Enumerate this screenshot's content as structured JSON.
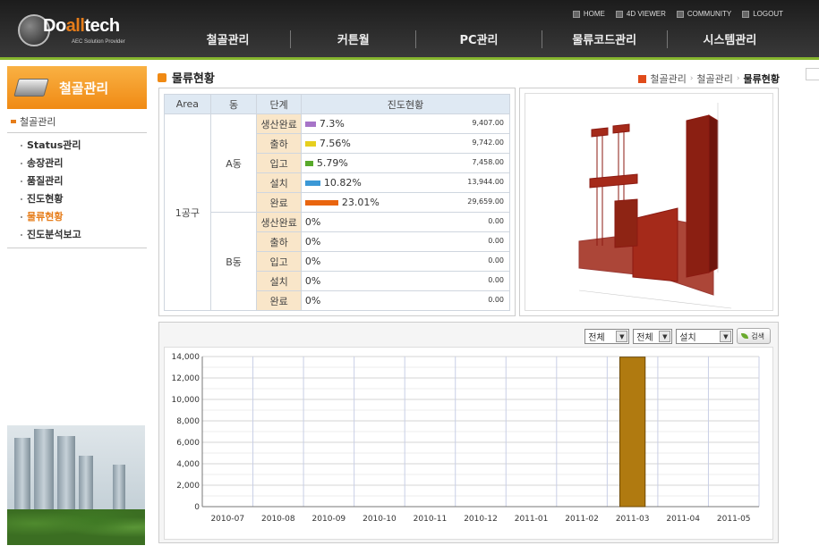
{
  "brand": {
    "logo_text_1": "Do",
    "logo_text_2": "all",
    "logo_text_3": "tech",
    "tagline": "AEC Solution Provider"
  },
  "top_menu": [
    {
      "label": "HOME",
      "icon": "square-bullet-icon"
    },
    {
      "label": "4D VIEWER",
      "icon": "square-bullet-icon"
    },
    {
      "label": "COMMUNITY",
      "icon": "square-bullet-icon"
    },
    {
      "label": "LOGOUT",
      "icon": "square-bullet-icon"
    }
  ],
  "main_nav": [
    "철골관리",
    "커튼월",
    "PC관리",
    "물류코드관리",
    "시스템관리"
  ],
  "sidebar": {
    "title": "철골관리",
    "section": "철골관리",
    "items": [
      {
        "label": "Status관리",
        "active": false
      },
      {
        "label": "송장관리",
        "active": false
      },
      {
        "label": "품질관리",
        "active": false
      },
      {
        "label": "진도현황",
        "active": false
      },
      {
        "label": "물류현황",
        "active": true
      },
      {
        "label": "진도분석보고",
        "active": false
      }
    ]
  },
  "page": {
    "title": "물류현황",
    "breadcrumb": [
      "철골관리",
      "철골관리",
      "물류현황"
    ]
  },
  "table": {
    "headers": [
      "Area",
      "동",
      "단계",
      "진도현황"
    ],
    "area": "1공구",
    "groups": [
      {
        "dong": "A동",
        "rows": [
          {
            "stage": "생산완료",
            "pct": "7.3%",
            "fraction": 0.073,
            "value": "9,407.00",
            "color": "#a774c8"
          },
          {
            "stage": "출하",
            "pct": "7.56%",
            "fraction": 0.0756,
            "value": "9,742.00",
            "color": "#e6cf1e"
          },
          {
            "stage": "입고",
            "pct": "5.79%",
            "fraction": 0.0579,
            "value": "7,458.00",
            "color": "#58a92a"
          },
          {
            "stage": "설치",
            "pct": "10.82%",
            "fraction": 0.1082,
            "value": "13,944.00",
            "color": "#3b98d6"
          },
          {
            "stage": "완료",
            "pct": "23.01%",
            "fraction": 0.2301,
            "value": "29,659.00",
            "color": "#e9650f"
          }
        ]
      },
      {
        "dong": "B동",
        "rows": [
          {
            "stage": "생산완료",
            "pct": "0%",
            "fraction": 0,
            "value": "0.00",
            "color": "#a774c8"
          },
          {
            "stage": "출하",
            "pct": "0%",
            "fraction": 0,
            "value": "0.00",
            "color": "#e6cf1e"
          },
          {
            "stage": "입고",
            "pct": "0%",
            "fraction": 0,
            "value": "0.00",
            "color": "#58a92a"
          },
          {
            "stage": "설치",
            "pct": "0%",
            "fraction": 0,
            "value": "0.00",
            "color": "#3b98d6"
          },
          {
            "stage": "완료",
            "pct": "0%",
            "fraction": 0,
            "value": "0.00",
            "color": "#e9650f"
          }
        ]
      }
    ]
  },
  "filters": {
    "select1": "전체",
    "select2": "전체",
    "select3": "설치",
    "search_label": "검색"
  },
  "chart_data": {
    "type": "bar",
    "categories": [
      "2010-07",
      "2010-08",
      "2010-09",
      "2010-10",
      "2010-11",
      "2010-12",
      "2011-01",
      "2011-02",
      "2011-03",
      "2011-04",
      "2011-05"
    ],
    "values": [
      0,
      0,
      0,
      0,
      0,
      0,
      0,
      0,
      13944,
      0,
      0
    ],
    "ylim": [
      0,
      14000
    ],
    "yticks": [
      "0",
      "2,000",
      "4,000",
      "6,000",
      "8,000",
      "10,000",
      "12,000",
      "14,000"
    ],
    "ytick_values": [
      0,
      2000,
      4000,
      6000,
      8000,
      10000,
      12000,
      14000
    ],
    "bar_color": "#b07a10",
    "grid": true,
    "title": "",
    "xlabel": "",
    "ylabel": ""
  }
}
